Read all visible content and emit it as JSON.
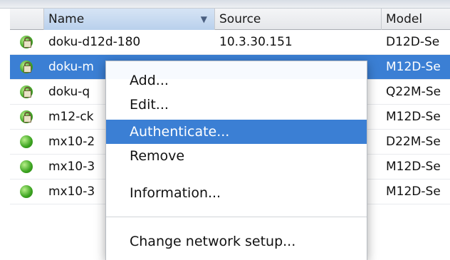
{
  "table": {
    "columns": {
      "name": "Name",
      "source": "Source",
      "model": "Model"
    },
    "sort_indicator": "▼",
    "rows": [
      {
        "status": "lock-icon",
        "name": "doku-d12d-180",
        "source": "10.3.30.151",
        "model": "D12D-Se",
        "selected": false
      },
      {
        "status": "lock-icon",
        "name": "doku-m",
        "source": "",
        "model": "M12D-Se",
        "selected": true
      },
      {
        "status": "lock-icon",
        "name": "doku-q",
        "source": "",
        "model": "Q22M-Se",
        "selected": false
      },
      {
        "status": "lock-icon",
        "name": "m12-ck",
        "source": "",
        "model": "M12D-Se",
        "selected": false
      },
      {
        "status": "green-dot-icon",
        "name": "mx10-2",
        "source": "",
        "model": "D22M-Se",
        "selected": false
      },
      {
        "status": "green-dot-icon",
        "name": "mx10-3",
        "source": "",
        "model": "M12D-Se",
        "selected": false
      },
      {
        "status": "green-dot-icon",
        "name": "mx10-3",
        "source": "",
        "model": "M12D-Se",
        "selected": false
      }
    ]
  },
  "context_menu": {
    "items": [
      {
        "label": "Add..."
      },
      {
        "label": "Edit..."
      },
      {
        "label": "Authenticate...",
        "highlighted": true
      },
      {
        "label": "Remove"
      },
      {
        "label": "Information..."
      },
      {
        "label": "Change network setup..."
      }
    ]
  },
  "colors": {
    "selection": "#3b7fd4",
    "status_green": "#3aa21f"
  }
}
